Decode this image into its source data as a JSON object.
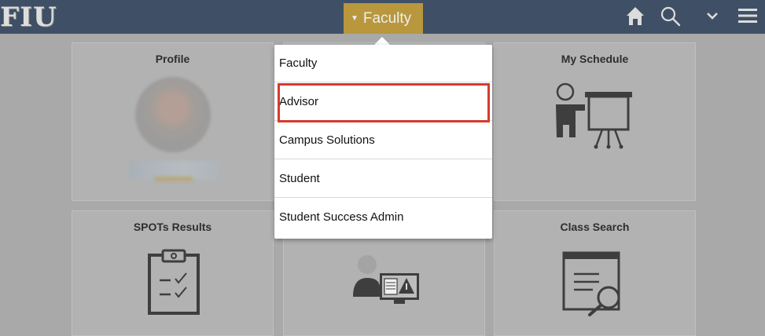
{
  "header": {
    "logo_text": "FIU",
    "role_selector": {
      "current": "Faculty",
      "caret_icon": "caret-down-icon"
    },
    "icons": [
      "home-icon",
      "search-icon",
      "chevron-down-icon",
      "hamburger-menu-icon"
    ],
    "colors": {
      "bar": "#3f5066",
      "role_button": "#b8973d"
    }
  },
  "tiles": [
    {
      "title": "Profile",
      "icon": "profile-photo"
    },
    {
      "title": "My Schedule",
      "icon": "presenter-board-icon"
    },
    {
      "title": "SPOTs Results",
      "icon": "clipboard-checklist-icon"
    },
    {
      "title": "",
      "icon": "advisor-monitor-icon"
    },
    {
      "title": "Class Search",
      "icon": "document-search-icon"
    }
  ],
  "role_menu": {
    "items": [
      "Faculty",
      "Advisor",
      "Campus Solutions",
      "Student",
      "Student Success Admin"
    ],
    "highlighted": "Advisor",
    "highlight_color": "#d63a2c"
  }
}
